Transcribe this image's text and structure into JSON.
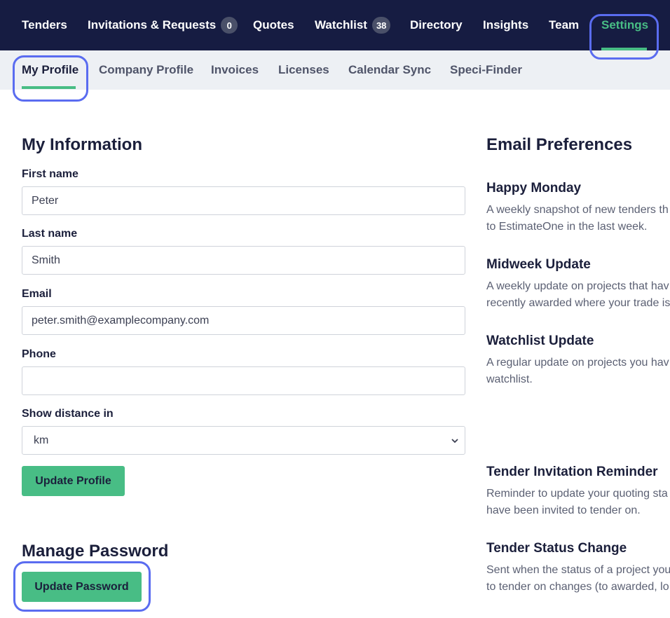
{
  "topnav": {
    "items": [
      {
        "label": "Tenders"
      },
      {
        "label": "Invitations & Requests",
        "badge": "0"
      },
      {
        "label": "Quotes"
      },
      {
        "label": "Watchlist",
        "badge": "38"
      },
      {
        "label": "Directory"
      },
      {
        "label": "Insights"
      },
      {
        "label": "Team"
      },
      {
        "label": "Settings"
      }
    ],
    "active": "Settings"
  },
  "subnav": {
    "items": [
      {
        "label": "My Profile"
      },
      {
        "label": "Company Profile"
      },
      {
        "label": "Invoices"
      },
      {
        "label": "Licenses"
      },
      {
        "label": "Calendar Sync"
      },
      {
        "label": "Speci-Finder"
      }
    ],
    "active": "My Profile"
  },
  "my_information": {
    "title": "My Information",
    "first_name": {
      "label": "First name",
      "value": "Peter"
    },
    "last_name": {
      "label": "Last name",
      "value": "Smith"
    },
    "email": {
      "label": "Email",
      "value": "peter.smith@examplecompany.com"
    },
    "phone": {
      "label": "Phone",
      "value": ""
    },
    "distance": {
      "label": "Show distance in",
      "value": "km"
    },
    "submit_label": "Update Profile"
  },
  "manage_password": {
    "title": "Manage Password",
    "button_label": "Update Password"
  },
  "email_preferences": {
    "title": "Email Preferences",
    "items": [
      {
        "title": "Happy Monday",
        "desc_line1": "A weekly snapshot of new tenders th",
        "desc_line2": "to EstimateOne in the last week."
      },
      {
        "title": "Midweek Update",
        "desc_line1": "A weekly update on projects that hav",
        "desc_line2": "recently awarded where your trade is"
      },
      {
        "title": "Watchlist Update",
        "desc_line1": "A regular update on projects you hav",
        "desc_line2": "watchlist."
      },
      {
        "title": "Tender Invitation Reminder",
        "desc_line1": "Reminder to update your quoting sta",
        "desc_line2": "have been invited to tender on."
      },
      {
        "title": "Tender Status Change",
        "desc_line1": "Sent when the status of a project you",
        "desc_line2": "to tender on changes (to awarded, lo"
      }
    ]
  },
  "colors": {
    "nav_bg": "#161c42",
    "accent_green": "#48bd85",
    "highlight_blue": "#5a6cf0",
    "subnav_bg": "#edf0f4"
  }
}
